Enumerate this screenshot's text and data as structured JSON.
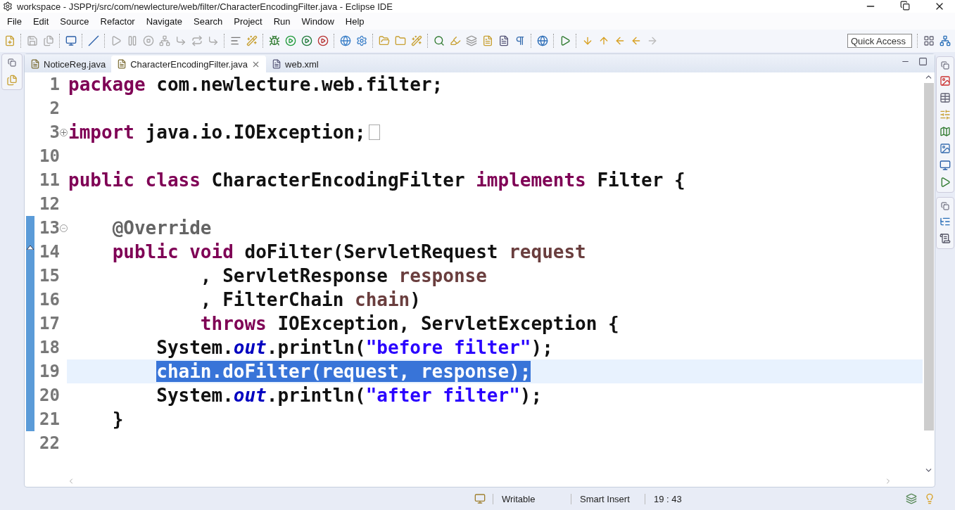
{
  "window": {
    "title": "workspace - JSPPrj/src/com/newlecture/web/filter/CharacterEncodingFilter.java - Eclipse IDE"
  },
  "menu": [
    {
      "label": "File"
    },
    {
      "label": "Edit"
    },
    {
      "label": "Source"
    },
    {
      "label": "Refactor"
    },
    {
      "label": "Navigate"
    },
    {
      "label": "Search"
    },
    {
      "label": "Project"
    },
    {
      "label": "Run"
    },
    {
      "label": "Window"
    },
    {
      "label": "Help"
    }
  ],
  "quick_access": {
    "placeholder": "Quick Access"
  },
  "tabs": [
    {
      "label": "NoticeReg.java",
      "kind": "java",
      "selected": false
    },
    {
      "label": "CharacterEncodingFilter.java",
      "kind": "java",
      "selected": true
    },
    {
      "label": "web.xml",
      "kind": "xml",
      "selected": false
    }
  ],
  "editor": {
    "lines": [
      {
        "number": "1",
        "current": false,
        "in_scope": false,
        "tokens": [
          {
            "kind": "keyword",
            "text": "package"
          },
          {
            "kind": "plain",
            "text": " com.newlecture.web.filter;"
          }
        ]
      },
      {
        "number": "2",
        "current": false,
        "in_scope": false
      },
      {
        "number": "3",
        "current": false,
        "in_scope": false,
        "foldable": true,
        "expanded": false,
        "tokens": [
          {
            "kind": "keyword",
            "text": "import"
          },
          {
            "kind": "plain",
            "text": " java.io.IOException;"
          }
        ]
      },
      {
        "number": "10",
        "current": false,
        "in_scope": false
      },
      {
        "number": "11",
        "current": false,
        "in_scope": false,
        "tokens": [
          {
            "kind": "keyword",
            "text": "public"
          },
          {
            "kind": "keyword",
            "text": " class"
          },
          {
            "kind": "plain",
            "text": " CharacterEncodingFilter"
          },
          {
            "kind": "keyword",
            "text": " implements"
          },
          {
            "kind": "plain",
            "text": " Filter {"
          }
        ]
      },
      {
        "number": "12",
        "current": false,
        "in_scope": false
      },
      {
        "number": "13",
        "current": false,
        "in_scope": true,
        "foldable": true,
        "expanded": true,
        "tokens": [
          {
            "kind": "annotation",
            "text": "    @Override"
          }
        ]
      },
      {
        "number": "14",
        "current": false,
        "in_scope": true,
        "override": true,
        "tokens": [
          {
            "kind": "keyword",
            "text": "    public"
          },
          {
            "kind": "keyword",
            "text": " void"
          },
          {
            "kind": "plain",
            "text": " doFilter(ServletRequest"
          },
          {
            "kind": "param",
            "text": " request"
          }
        ]
      },
      {
        "number": "15",
        "current": false,
        "in_scope": true,
        "tokens": [
          {
            "kind": "plain",
            "text": "            , ServletResponse"
          },
          {
            "kind": "param",
            "text": " response"
          }
        ]
      },
      {
        "number": "16",
        "current": false,
        "in_scope": true,
        "tokens": [
          {
            "kind": "plain",
            "text": "            , FilterChain"
          },
          {
            "kind": "param",
            "text": " chain"
          },
          {
            "kind": "plain",
            "text": ")"
          }
        ]
      },
      {
        "number": "17",
        "current": false,
        "in_scope": true,
        "tokens": [
          {
            "kind": "keyword",
            "text": "            throws"
          },
          {
            "kind": "plain",
            "text": " IOException, ServletException {"
          }
        ]
      },
      {
        "number": "18",
        "current": false,
        "in_scope": true,
        "tokens": [
          {
            "kind": "plain",
            "text": "        System."
          },
          {
            "kind": "field",
            "text": "out"
          },
          {
            "kind": "plain",
            "text": ".println("
          },
          {
            "kind": "string",
            "text": "\"before filter\""
          },
          {
            "kind": "plain",
            "text": ");"
          }
        ]
      },
      {
        "number": "19",
        "current": true,
        "in_scope": true,
        "tokens": [
          {
            "kind": "selected",
            "text": "        chain.doFilter(request, response);"
          }
        ]
      },
      {
        "number": "20",
        "current": false,
        "in_scope": true,
        "tokens": [
          {
            "kind": "plain",
            "text": "        System."
          },
          {
            "kind": "field",
            "text": "out"
          },
          {
            "kind": "plain",
            "text": ".println("
          },
          {
            "kind": "string",
            "text": "\"after filter\""
          },
          {
            "kind": "plain",
            "text": ");"
          }
        ]
      },
      {
        "number": "21",
        "current": false,
        "in_scope": true,
        "tokens": [
          {
            "kind": "plain",
            "text": "    }"
          }
        ]
      },
      {
        "number": "22",
        "current": false,
        "in_scope": false
      }
    ]
  },
  "status_bar": {
    "items": [
      {
        "label": "Writable"
      },
      {
        "label": "Smart Insert"
      },
      {
        "label": "19 : 43"
      }
    ]
  }
}
